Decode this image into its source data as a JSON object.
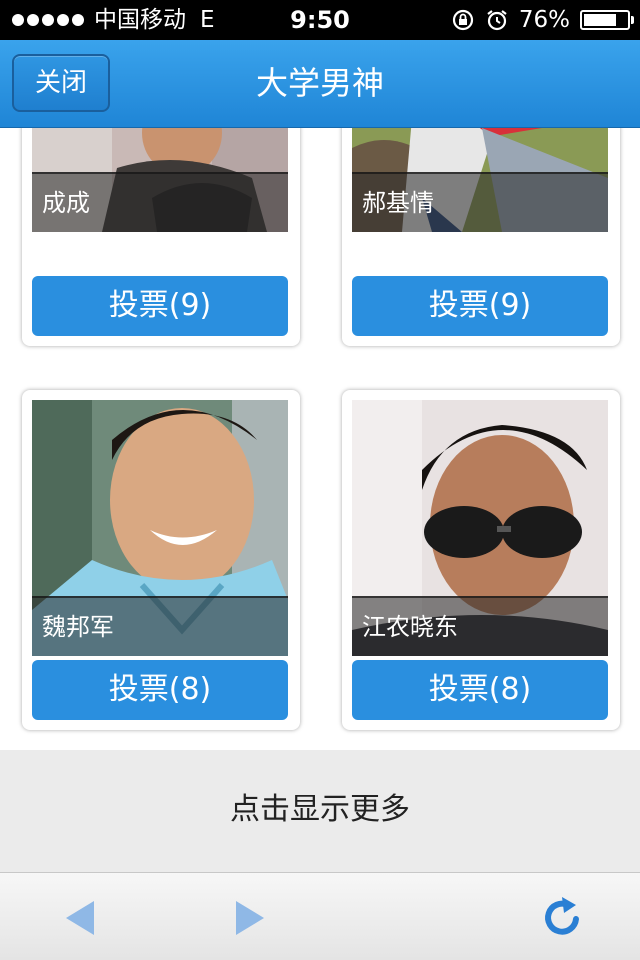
{
  "status_bar": {
    "carrier": "中国移动",
    "network": "E",
    "time": "9:50",
    "battery_percent": "76%",
    "battery_level": 0.76,
    "icons": [
      "orientation-lock-icon",
      "alarm-icon",
      "battery-icon"
    ]
  },
  "nav": {
    "close_label": "关闭",
    "title": "大学男神"
  },
  "cards": [
    {
      "name": "成成",
      "vote_label": "投票(9)"
    },
    {
      "name": "郝基情",
      "vote_label": "投票(9)"
    },
    {
      "name": "魏邦军",
      "vote_label": "投票(8)"
    },
    {
      "name": "江农晓东",
      "vote_label": "投票(8)"
    }
  ],
  "load_more_label": "点击显示更多",
  "toolbar": {
    "icons": [
      "back-arrow-icon",
      "forward-arrow-icon",
      "refresh-icon"
    ]
  },
  "colors": {
    "nav_blue": "#2a8fdf",
    "vote_blue": "#2a8fdf",
    "toolbar_icon_blue": "#2a7fd4"
  }
}
